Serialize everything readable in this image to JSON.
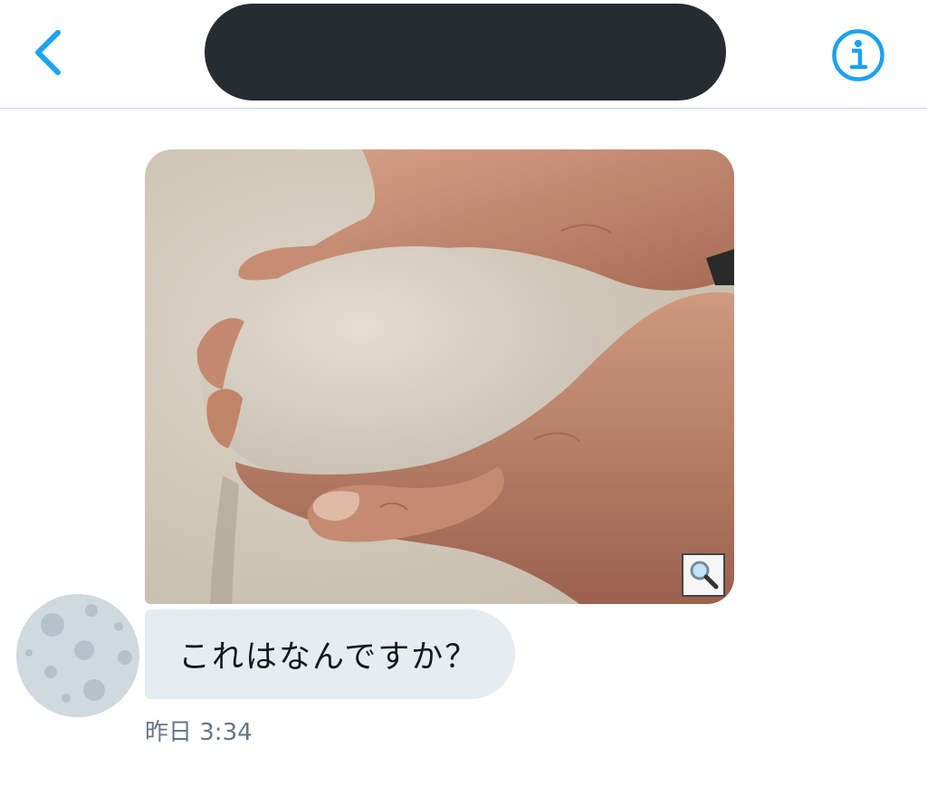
{
  "header": {
    "back_icon": "chevron-left-icon",
    "title_redacted": true,
    "info_icon": "info-circle-icon",
    "accent_color": "#1da1f2"
  },
  "conversation": {
    "media_message": {
      "image_subject": "cupped hands holding sand",
      "zoom_icon": "magnifier-icon"
    },
    "text_message": {
      "text": "これはなんですか？",
      "timestamp": "昨日 3:34"
    },
    "avatar": {
      "icon": "moon-avatar-icon"
    }
  },
  "colors": {
    "bubble_background": "#e6ecf0",
    "timestamp": "#657786",
    "divider": "#c9d5dd"
  }
}
